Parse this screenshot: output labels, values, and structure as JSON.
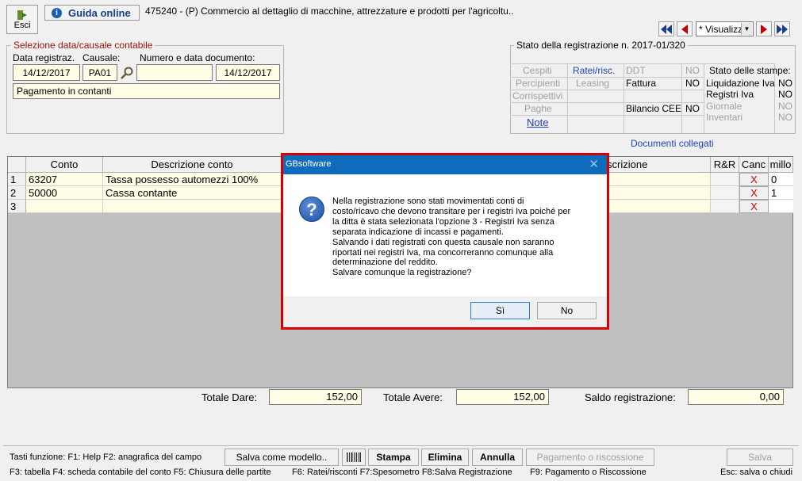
{
  "toolbar": {
    "exit_label": "Esci",
    "guide_label": "Guida online",
    "company": "475240 - (P) Commercio al dettaglio di macchine, attrezzature e prodotti per l'agricoltu.."
  },
  "nav": {
    "view_select": "* Visualizz"
  },
  "selection": {
    "title": "Selezione data/causale contabile",
    "date_label": "Data registraz.",
    "causal_label": "Causale:",
    "docnum_label": "Numero e data documento:",
    "date_value": "14/12/2017",
    "causal_value": "PA01",
    "docnum_value": "",
    "docdate_value": "14/12/2017",
    "description_value": "Pagamento in contanti"
  },
  "status": {
    "title": "Stato della registrazione n. 2017-01/320",
    "cespiti": "Cespiti",
    "ratei": "Ratei/risc.",
    "ddt": "DDT",
    "ddt_flag": "NO",
    "percipienti": "Percipienti",
    "leasing": "Leasing",
    "fattura": "Fattura",
    "fattura_flag": "NO",
    "corrispettivi": "Corrispettivi",
    "paghe": "Paghe",
    "bilancio": "Bilancio CEE",
    "bilancio_flag": "NO",
    "note": "Note",
    "prints_title": "Stato delle stampe:",
    "liq_iva": "Liquidazione Iva",
    "liq_iva_flag": "NO",
    "reg_iva": "Registri Iva",
    "reg_iva_flag": "NO",
    "giornale": "Giornale",
    "giornale_flag": "NO",
    "inventari": "Inventari",
    "inventari_flag": "NO"
  },
  "documents_link": "Documenti collegati",
  "grid": {
    "headers": {
      "conto": "Conto",
      "descr": "Descrizione conto",
      "descr2": "scrizione",
      "rr": "R&R",
      "canc": "Canc",
      "millo": "millo"
    },
    "rows": [
      {
        "n": "1",
        "conto": "63207",
        "descr": "Tassa possesso automezzi 100%",
        "canc": "X",
        "millo": "0"
      },
      {
        "n": "2",
        "conto": "50000",
        "descr": "Cassa contante",
        "canc": "X",
        "millo": "1"
      },
      {
        "n": "3",
        "conto": "",
        "descr": "",
        "canc": "X",
        "millo": ""
      }
    ]
  },
  "totals": {
    "dare_label": "Totale Dare:",
    "dare_value": "152,00",
    "avere_label": "Totale Avere:",
    "avere_value": "152,00",
    "saldo_label": "Saldo registrazione:",
    "saldo_value": "0,00"
  },
  "bottom": {
    "keys1": "Tasti funzione:  F1: Help   F2: anagrafica del campo",
    "save_model": "Salva come modello..",
    "stampa": "Stampa",
    "elimina": "Elimina",
    "annulla": "Annulla",
    "pagamento": "Pagamento o riscossione",
    "salva": "Salva",
    "keys2": "F3: tabella   F4: scheda contabile del conto   F5: Chiusura delle partite",
    "keys3": "F6: Ratei/risconti   F7:Spesometro   F8:Salva Registrazione",
    "keys4": "F9: Pagamento o Riscossione",
    "keys5": "Esc: salva o chiudi"
  },
  "dialog": {
    "title": "GBsoftware",
    "message_lines": [
      "Nella registrazione sono stati movimentati conti di",
      "costo/ricavo che devono transitare per i registri Iva poiché per",
      "la ditta è stata selezionata l'opzione 3 - Registri Iva senza",
      "separata indicazione di incassi e pagamenti.",
      "Salvando i dati registrati con questa causale non saranno",
      "riportati nei registri Iva, ma concorreranno comunque alla",
      "determinazione del reddito.",
      "Salvare comunque la registrazione?"
    ],
    "yes": "Sì",
    "no": "No"
  },
  "colors": {
    "accent_red": "#d50000",
    "link_blue": "#1f3fbf",
    "dialog_title_bg": "#0f6cbd"
  }
}
